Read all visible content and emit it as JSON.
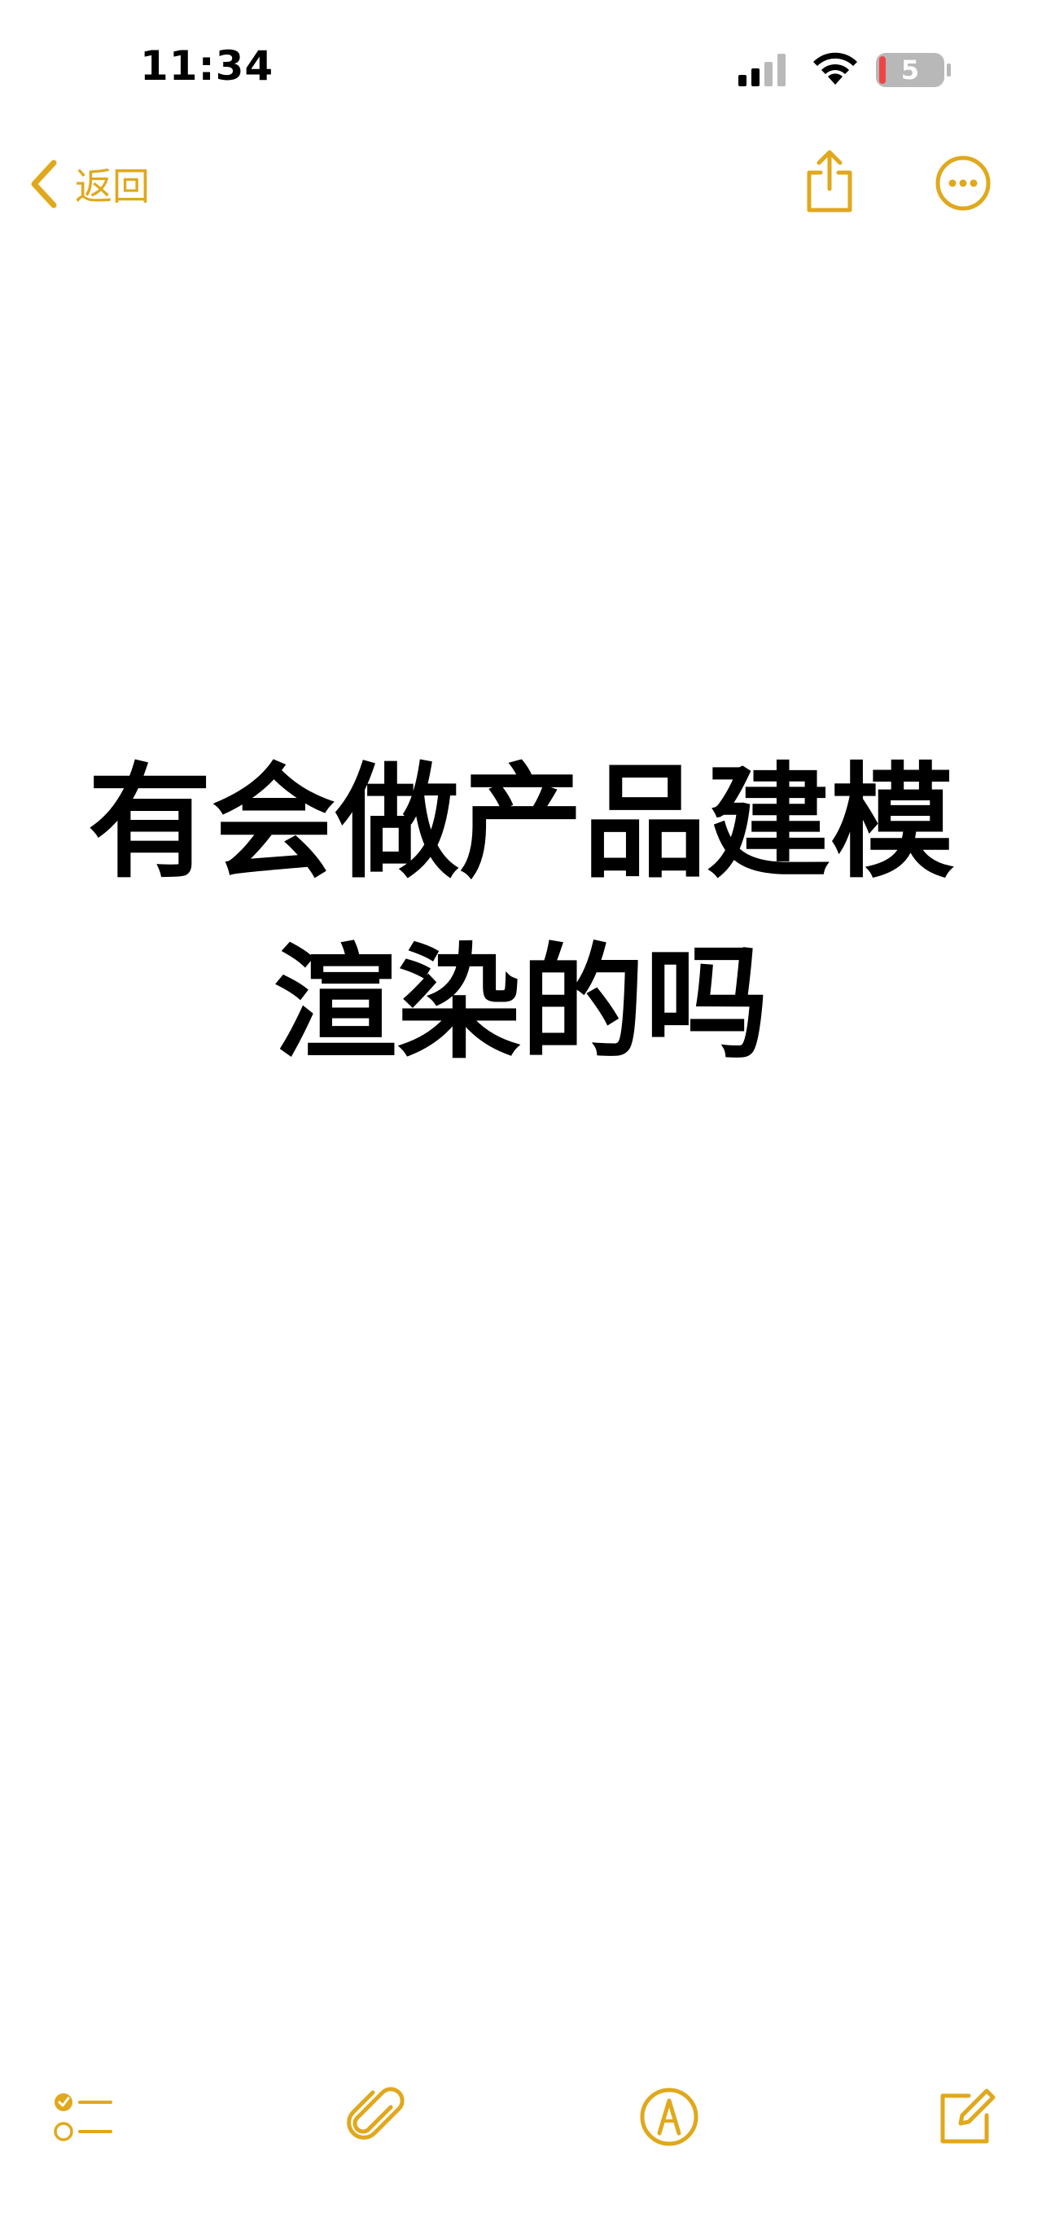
{
  "status_bar": {
    "time": "11:34",
    "battery_level": "5",
    "battery_color": "#ef4444",
    "icons": [
      "cellular-signal-icon",
      "wifi-icon",
      "battery-icon"
    ]
  },
  "nav": {
    "back_label": "返回",
    "accent_color": "#e0a81c",
    "icons": [
      "chevron-left-icon",
      "share-icon",
      "more-icon"
    ]
  },
  "note": {
    "lines": [
      "有会做产品建模",
      "渲染的吗"
    ]
  },
  "toolbar": {
    "icons": [
      "checklist-icon",
      "paperclip-icon",
      "markup-pen-icon",
      "compose-icon"
    ]
  }
}
